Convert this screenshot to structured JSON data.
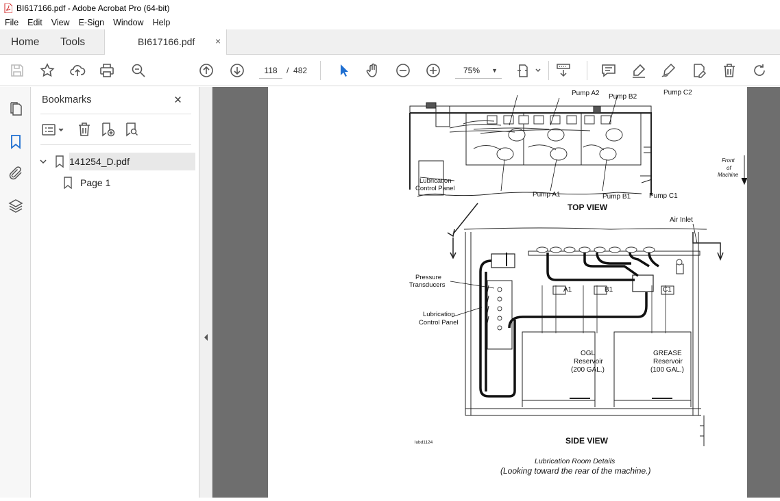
{
  "window": {
    "title": "BI617166.pdf - Adobe Acrobat Pro (64-bit)"
  },
  "menu": [
    "File",
    "Edit",
    "View",
    "E-Sign",
    "Window",
    "Help"
  ],
  "tabs": {
    "home": "Home",
    "tools": "Tools",
    "document": "BI617166.pdf",
    "close": "×"
  },
  "toolbar": {
    "page_current": "118",
    "page_separator": "/",
    "page_total": "482",
    "zoom": "75%",
    "icons": [
      "save-icon",
      "bookmark-star-icon",
      "upload-icon",
      "print-icon",
      "zoom-search-icon",
      "page-up-icon",
      "page-down-icon",
      "select-arrow-icon",
      "hand-icon",
      "zoom-out-icon",
      "zoom-in-icon",
      "fit-page-icon",
      "scroll-mode-icon",
      "comment-icon",
      "highlight-icon",
      "sign-icon",
      "edit-pdf-icon",
      "delete-icon",
      "redo-icon"
    ]
  },
  "bookmarks": {
    "title": "Bookmarks",
    "close": "×",
    "items": [
      {
        "label": "141254_D.pdf",
        "expanded": true
      },
      {
        "label": "Page 1"
      }
    ]
  },
  "drawing": {
    "top_labels": {
      "pump_a2": "Pump A2",
      "pump_b2": "Pump B2",
      "pump_c2": "Pump C2",
      "pump_a1": "Pump A1",
      "pump_b1": "Pump B1",
      "pump_c1": "Pump C1",
      "lub_panel_1": "Lubrication",
      "lub_panel_2": "Control Panel",
      "front_1": "Front",
      "front_2": "of",
      "front_3": "Machine"
    },
    "top_view": "TOP VIEW",
    "side_labels": {
      "air_inlet": "Air Inlet",
      "pressure_1": "Pressure",
      "pressure_2": "Transducers",
      "lub_1": "Lubrication",
      "lub_2": "Control Panel",
      "a1": "A1",
      "b1": "B1",
      "c1": "C1",
      "ogl_1": "OGL",
      "ogl_2": "Reservoir",
      "ogl_3": "(200 GAL.)",
      "grease_1": "GREASE",
      "grease_2": "Reservoir",
      "grease_3": "(100 GAL.)"
    },
    "side_view": "SIDE VIEW",
    "code": "lubd1124",
    "caption": "Lubrication Room Details",
    "caption2": "(Looking toward the rear of the machine.)"
  }
}
